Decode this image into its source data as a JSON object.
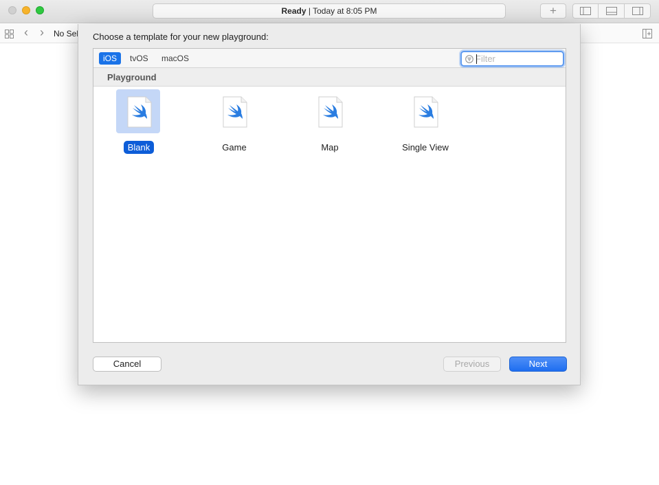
{
  "window": {
    "status_state": "Ready",
    "status_separator": "|",
    "status_time": "Today at 8:05 PM",
    "add_symbol": "+"
  },
  "jumpbar": {
    "selection_text": "No Sele",
    "back_symbol": "‹",
    "forward_symbol": "›"
  },
  "sheet": {
    "title": "Choose a template for your new playground:",
    "tabs": [
      {
        "label": "iOS",
        "active": true
      },
      {
        "label": "tvOS",
        "active": false
      },
      {
        "label": "macOS",
        "active": false
      }
    ],
    "filter": {
      "placeholder": "Filter",
      "value": ""
    },
    "section_title": "Playground",
    "templates": [
      {
        "label": "Blank",
        "selected": true
      },
      {
        "label": "Game",
        "selected": false
      },
      {
        "label": "Map",
        "selected": false
      },
      {
        "label": "Single View",
        "selected": false
      }
    ],
    "buttons": {
      "cancel": "Cancel",
      "previous": "Previous",
      "next": "Next"
    }
  },
  "colors": {
    "accent": "#1a73e8",
    "selection_bg": "#c4d7f7",
    "selection_label": "#0d5dd8",
    "swift_orange": "#f05138",
    "swift_bird": "#2a7de1"
  },
  "icons": {
    "template_icon": "swift-bird-document-icon",
    "filter_icon": "filter-lines-icon"
  }
}
